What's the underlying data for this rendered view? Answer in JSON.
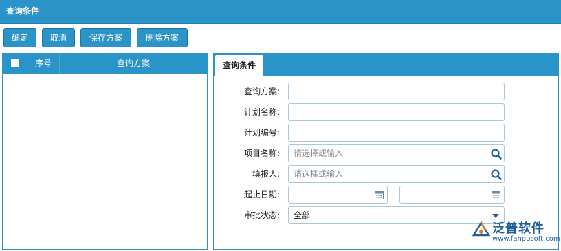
{
  "window": {
    "title": "查询条件"
  },
  "toolbar": {
    "confirm_label": "确定",
    "cancel_label": "取消",
    "save_plan_label": "保存方案",
    "delete_plan_label": "删除方案"
  },
  "plan_grid": {
    "columns": {
      "seq": "序号",
      "plan": "查询方案"
    },
    "rows": []
  },
  "conditions": {
    "tab_label": "查询条件",
    "plan_label": "查询方案:",
    "plan_value": "",
    "plan_name_label": "计划名称:",
    "plan_name_value": "",
    "plan_no_label": "计划编号:",
    "plan_no_value": "",
    "project_label": "项目名称:",
    "project_placeholder": "请选择或输入",
    "reporter_label": "填报人:",
    "reporter_placeholder": "请选择或输入",
    "date_label": "起止日期:",
    "date_separator": "—",
    "date_start": "",
    "date_end": "",
    "status_label": "审批状态:",
    "status_value": "全部"
  },
  "logo": {
    "text": "泛普软件",
    "url": "www.fanpusoft.com"
  },
  "colors": {
    "primary": "#2a93c7",
    "border": "#a9c7dc",
    "logo": "#1f5f99"
  }
}
